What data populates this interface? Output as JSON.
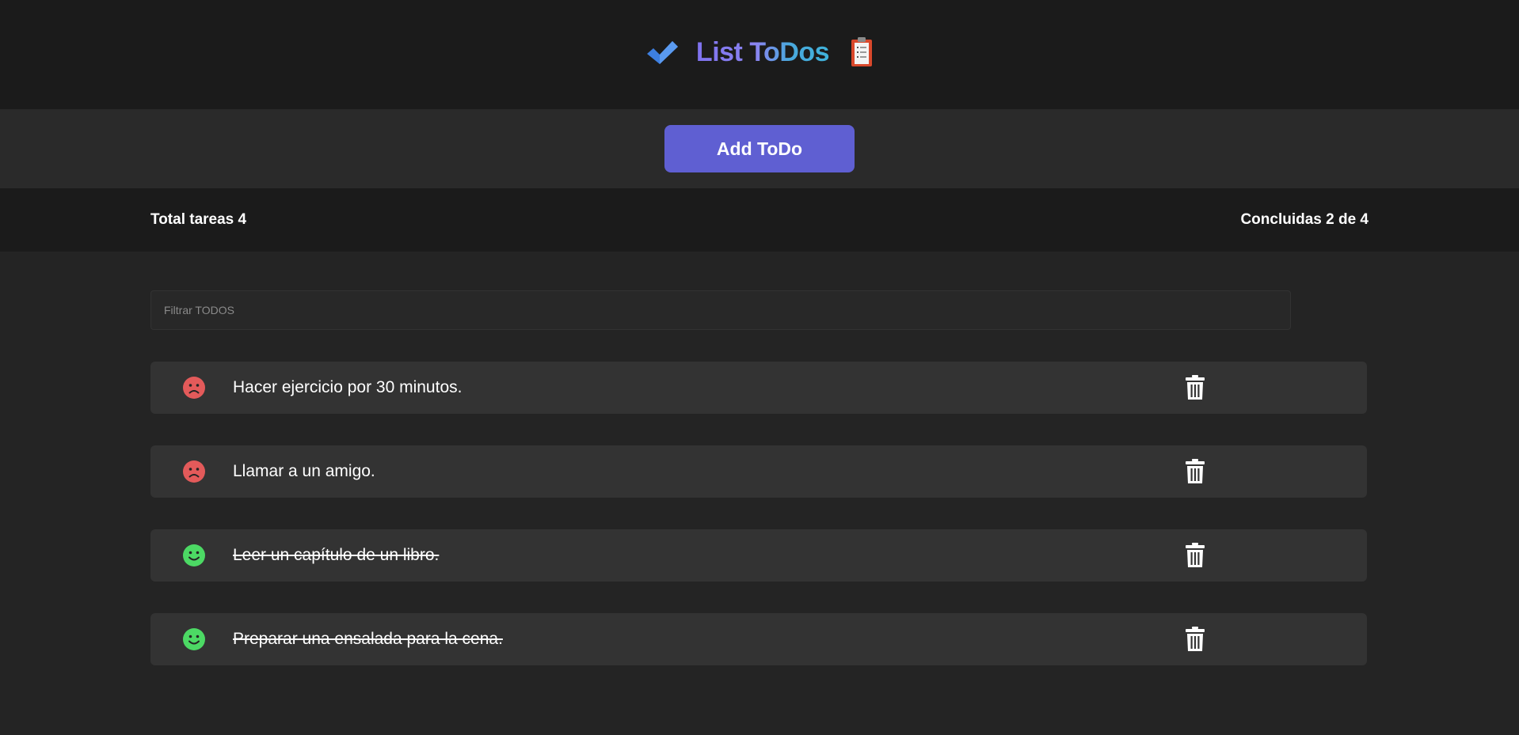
{
  "header": {
    "title": "List ToDos",
    "left_icon": "check-icon",
    "right_icon": "clipboard-icon",
    "colors": {
      "check": "#3d7fe0",
      "title_start": "#7f72ef",
      "title_end": "#3fb2da"
    }
  },
  "toolbar": {
    "add_label": "Add ToDo",
    "add_color": "#5f5fd2"
  },
  "stats": {
    "total_label": "Total tareas 4",
    "completed_label": "Concluidas 2 de 4"
  },
  "filter": {
    "placeholder": "Filtrar TODOS",
    "value": ""
  },
  "todos": [
    {
      "text": "Hacer ejercicio por 30 minutos.",
      "completed": false,
      "status_icon": "sad-face-icon",
      "status_color": "#e35a5a"
    },
    {
      "text": "Llamar a un amigo.",
      "completed": false,
      "status_icon": "sad-face-icon",
      "status_color": "#e35a5a"
    },
    {
      "text": "Leer un capítulo de un libro.",
      "completed": true,
      "status_icon": "happy-face-icon",
      "status_color": "#4cd964"
    },
    {
      "text": "Preparar una ensalada para la cena.",
      "completed": true,
      "status_icon": "happy-face-icon",
      "status_color": "#4cd964"
    }
  ]
}
